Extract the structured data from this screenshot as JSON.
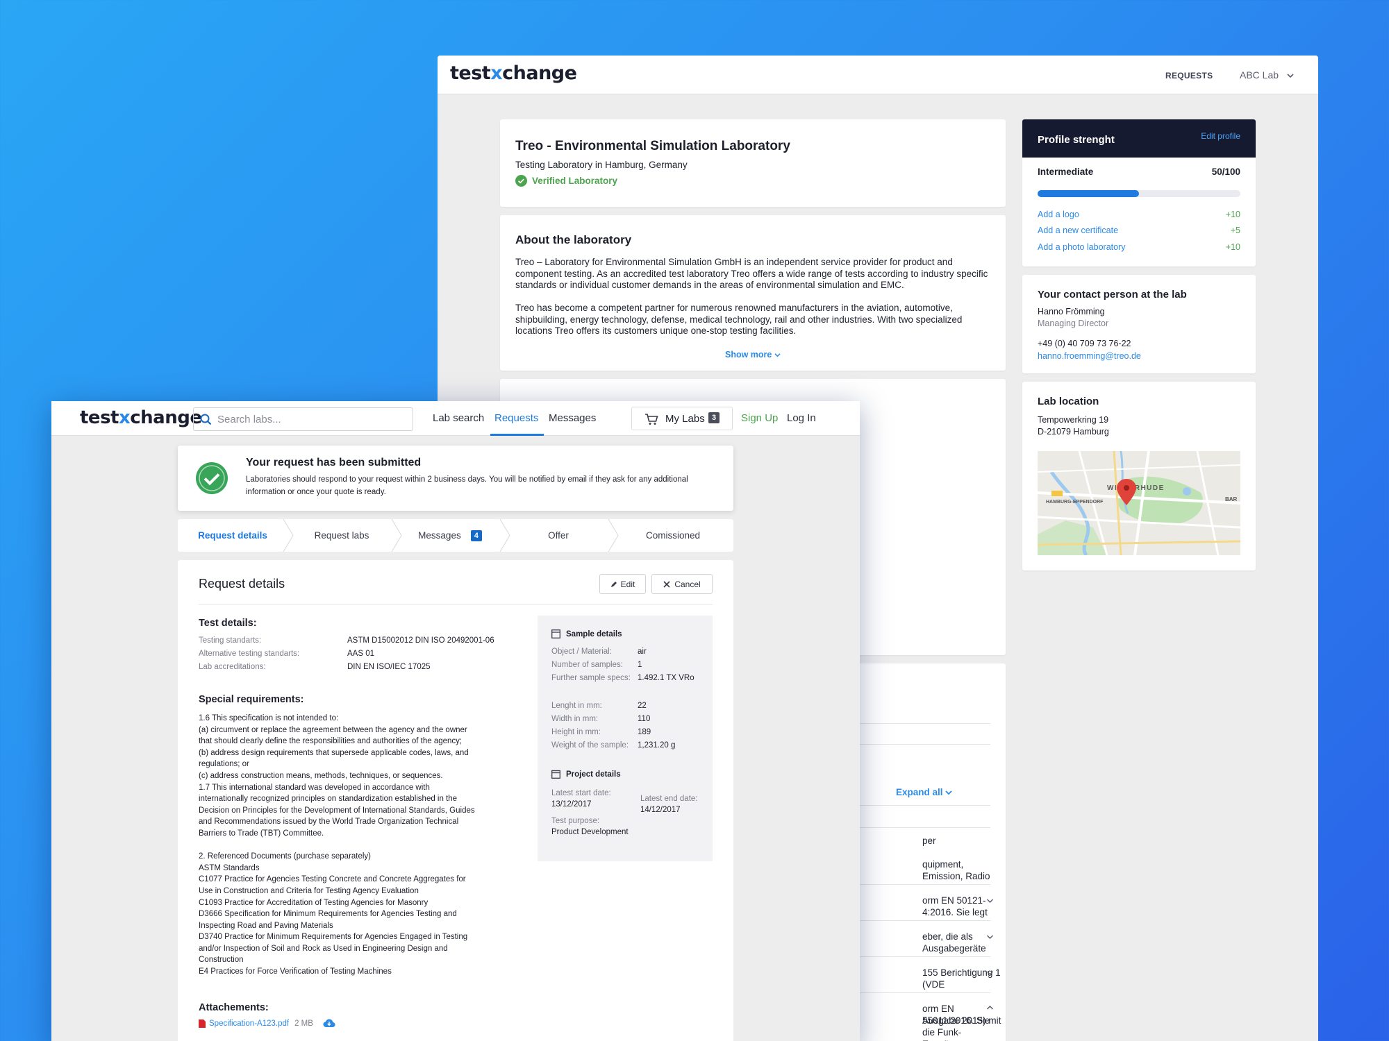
{
  "brand": {
    "logo_pre": "test",
    "logo_x": "x",
    "logo_post": "change"
  },
  "back": {
    "nav_requests": "REQUESTS",
    "nav_lab": "ABC Lab",
    "lab": {
      "name": "Treo - Environmental Simulation Laboratory",
      "subtitle": "Testing Laboratory in Hamburg, Germany",
      "verified": "Verified Laboratory"
    },
    "about": {
      "title": "About the laboratory",
      "p1": "Treo – Laboratory for Environmental Simulation GmbH is an independent service provider for product and component testing. As an accredited test laboratory Treo offers a wide range of tests according to industry specific standards or individual customer demands in the areas of environmental simulation and EMC.",
      "p2": "Treo has become a competent partner for numerous renowned manufacturers in the aviation, automotive, shipbuilding, energy technology, defense, medical technology, rail and other industries. With two specialized locations Treo offers its customers unique one-stop testing facilities.",
      "show_more": "Show more"
    },
    "profile": {
      "title": "Profile strenght",
      "edit": "Edit profile",
      "level": "Intermediate",
      "score": "50/100",
      "progress": 0.5,
      "items": [
        {
          "label": "Add a logo",
          "pts": "+10"
        },
        {
          "label": "Add a new certificate",
          "pts": "+5"
        },
        {
          "label": "Add a photo laboratory",
          "pts": "+10"
        }
      ]
    },
    "contact": {
      "title": "Your contact person at the lab",
      "name": "Hanno Frömming",
      "role": "Managing Director",
      "phone": "+49 (0) 40 709 73 76-22",
      "email": "hanno.froemming@treo.de"
    },
    "location": {
      "title": "Lab location",
      "street": "Tempowerkring 19",
      "city": "D-21079 Hamburg",
      "map_label1": "HAMBURG-EPPENDORF",
      "map_label2": "WINTERHUDE",
      "map_label3": "BAR"
    },
    "expand_all": "Expand all",
    "list": [
      "per",
      "quipment, Emission, Radio",
      "orm EN 50121-4:2016. Sie legt",
      "eber, die als Ausgabegeräte",
      "155 Berichtigung 1 (VDE",
      "orm EN 55011:2016. Sie",
      "Ausgabe 2015) mit",
      "die Funk-Entstörung von"
    ]
  },
  "front": {
    "search_placeholder": "Search labs...",
    "nav": [
      "Lab search",
      "Requests",
      "Messages"
    ],
    "my_labs": "My Labs",
    "my_labs_count": "3",
    "signup": "Sign Up",
    "login": "Log In",
    "banner": {
      "title": "Your request has been submitted",
      "text1": "Laboratories should respond to your request within 2 business days. You will be notified by email if they ask for any additional",
      "text2": "information or once your quote is ready."
    },
    "steps": [
      "Request details",
      "Request labs",
      "Messages",
      "Offer",
      "Comissioned"
    ],
    "messages_count": "4",
    "details": {
      "title": "Request details",
      "edit": "Edit",
      "cancel": "Cancel",
      "test_title": "Test details:",
      "fields": [
        {
          "k": "Testing standarts:",
          "v": "ASTM D15002012 DIN ISO 20492001-06"
        },
        {
          "k": "Alternative testing standarts:",
          "v": "AAS 01"
        },
        {
          "k": "Lab accreditations:",
          "v": "DIN EN ISO/IEC  17025"
        }
      ],
      "special_title": "Special requirements:",
      "special": "1.6 This specification is not intended to:\n(a) circumvent or replace the agreement between the agency and the owner\nthat should clearly define the responsibilities and authorities of the agency;\n(b) address design requirements that supersede applicable codes, laws, and\nregulations; or\n(c) address construction means, methods, techniques, or sequences.\n1.7 This international standard was developed in accordance with\ninternationally recognized principles on standardization established in the\nDecision on Principles for the Development of International Standards, Guides\nand Recommendations issued by the World Trade Organization Technical\nBarriers to Trade (TBT) Committee.\n\n2. Referenced Documents (purchase separately)\nASTM Standards\nC1077 Practice for Agencies Testing Concrete and Concrete Aggregates for\nUse in Construction and Criteria for Testing Agency Evaluation\nC1093 Practice for Accreditation of Testing Agencies for Masonry\nD3666 Specification for Minimum Requirements for Agencies Testing and\nInspecting Road and Paving Materials\nD3740 Practice for Minimum Requirements for Agencies Engaged in Testing\nand/or Inspection of Soil and Rock as Used in Engineering Design and\nConstruction\nE4 Practices for Force Verification of Testing Machines",
      "attach_title": "Attachements:",
      "file": "Specification-A123.pdf",
      "file_size": "2 MB"
    },
    "sample": {
      "title": "Sample details",
      "rows1": [
        {
          "k": "Object / Material:",
          "v": "air"
        },
        {
          "k": "Number of samples:",
          "v": "1"
        },
        {
          "k": "Further sample specs:",
          "v": "1.492.1 TX VRo"
        }
      ],
      "rows2": [
        {
          "k": "Lenght in mm:",
          "v": "22"
        },
        {
          "k": "Width in mm:",
          "v": "110"
        },
        {
          "k": "Height in mm:",
          "v": "189"
        },
        {
          "k": "Weight of the sample:",
          "v": "1,231.20 g"
        }
      ]
    },
    "project": {
      "title": "Project details",
      "start_label": "Latest start date:",
      "start": "13/12/2017",
      "end_label": "Latest end date:",
      "end": "14/12/2017",
      "purpose_label": "Test purpose:",
      "purpose": "Product Development"
    }
  }
}
